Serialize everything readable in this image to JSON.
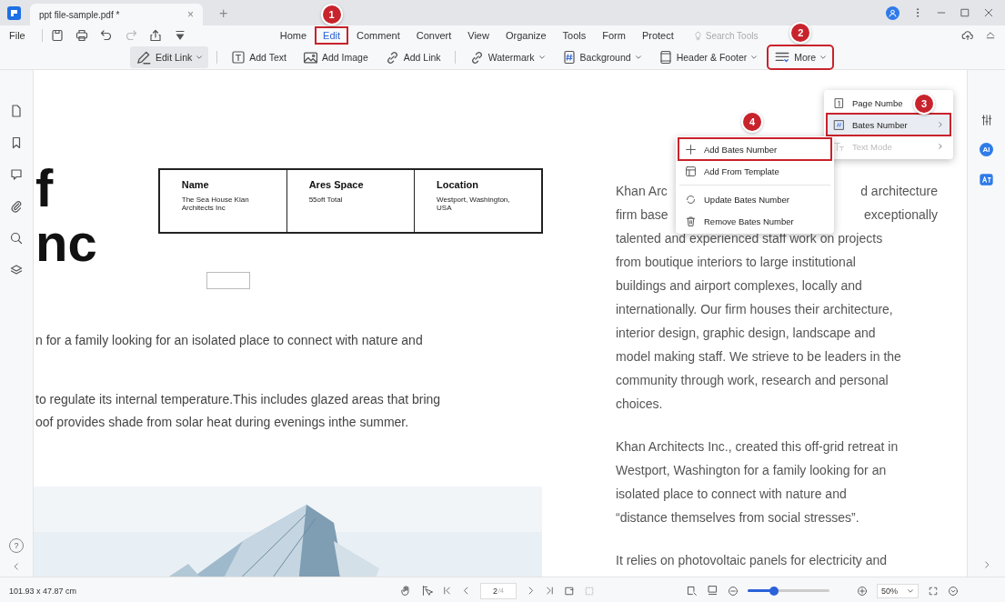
{
  "app_tab": {
    "title": "ppt file-sample.pdf *",
    "close": "×"
  },
  "new_tab": "+",
  "menu_bar": {
    "file": "File",
    "search_placeholder": "Search Tools",
    "tabs": [
      {
        "label": "Home",
        "selected": false,
        "outlined": false
      },
      {
        "label": "Edit",
        "selected": true,
        "outlined": true,
        "step": "1"
      },
      {
        "label": "Comment",
        "selected": false,
        "outlined": false
      },
      {
        "label": "Convert",
        "selected": false,
        "outlined": false
      },
      {
        "label": "View",
        "selected": false,
        "outlined": false
      },
      {
        "label": "Organize",
        "selected": false,
        "outlined": false
      },
      {
        "label": "Tools",
        "selected": false,
        "outlined": false
      },
      {
        "label": "Form",
        "selected": false,
        "outlined": false
      },
      {
        "label": "Protect",
        "selected": false,
        "outlined": false
      }
    ]
  },
  "toolbar": [
    {
      "label": "Edit Link",
      "dropdown": true,
      "selected": true,
      "outlined": false
    },
    {
      "label": "Add Text",
      "dropdown": false,
      "selected": false,
      "outlined": false
    },
    {
      "label": "Add Image",
      "dropdown": false,
      "selected": false,
      "outlined": false
    },
    {
      "label": "Add Link",
      "dropdown": false,
      "selected": false,
      "outlined": false
    },
    {
      "label": "Watermark",
      "dropdown": true,
      "selected": false,
      "outlined": false
    },
    {
      "label": "Background",
      "dropdown": true,
      "selected": false,
      "outlined": false
    },
    {
      "label": "Header & Footer",
      "dropdown": true,
      "selected": false,
      "outlined": false
    },
    {
      "label": "More",
      "dropdown": true,
      "selected": false,
      "outlined": true,
      "step": "2"
    }
  ],
  "more_menu": [
    {
      "label": "Page Numbe",
      "selected": false,
      "disabled": false,
      "submenu": false,
      "outlined": false
    },
    {
      "label": "Bates Number",
      "selected": true,
      "disabled": false,
      "submenu": true,
      "outlined": true,
      "step": "3"
    },
    {
      "label": "Text Mode",
      "selected": false,
      "disabled": true,
      "submenu": true,
      "outlined": false
    }
  ],
  "bates_menu": [
    {
      "label": "Add Bates Number",
      "outlined": true,
      "step": "4"
    },
    {
      "label": "Add From Template",
      "outlined": false
    },
    {
      "label": "Update Bates Number",
      "outlined": false
    },
    {
      "label": "Remove Bates Number",
      "outlined": false
    }
  ],
  "left_page": {
    "title_lines": [
      "f",
      "nc"
    ],
    "table": {
      "columns": [
        "Name",
        "Ares Space",
        "Location"
      ],
      "rows": [
        [
          "The Sea House Klan Architects Inc",
          "55oft Total",
          "Westport, Washington, USA"
        ]
      ]
    },
    "lines": [
      "n for a family looking for an isolated place to connect with nature and",
      "to regulate its internal temperature.This includes glazed areas that bring",
      "oof provides shade from solar heat during evenings inthe summer."
    ]
  },
  "right_page": {
    "paragraphs": [
      [
        [
          "Khan Arc",
          "d architecture"
        ],
        [
          "firm base",
          "exceptionally"
        ],
        [
          "talented and experienced staff work on projects"
        ],
        [
          "from boutique interiors to large institutional"
        ],
        [
          "buildings and airport complexes, locally and"
        ],
        [
          "internationally. Our firm houses their architecture,"
        ],
        [
          "interior design, graphic design, landscape and"
        ],
        [
          "model making staff. We strieve to be leaders in the"
        ],
        [
          "community through work, research and personal"
        ],
        [
          "choices."
        ]
      ],
      [
        [
          "Khan Architects Inc., created this off-grid retreat in"
        ],
        [
          "Westport, Washington for a family looking for an"
        ],
        [
          "isolated place to connect with nature and"
        ],
        [
          "“distance themselves from social stresses”."
        ]
      ],
      [
        [
          "It relies on photovoltaic panels for electricity and"
        ]
      ]
    ]
  },
  "help": "?",
  "ai_badge": "AI",
  "status_bar": {
    "dimensions": "101.93 x 47.87 cm",
    "page": "2",
    "page_total": "/4",
    "level": 0.3,
    "zoom": "50%"
  }
}
